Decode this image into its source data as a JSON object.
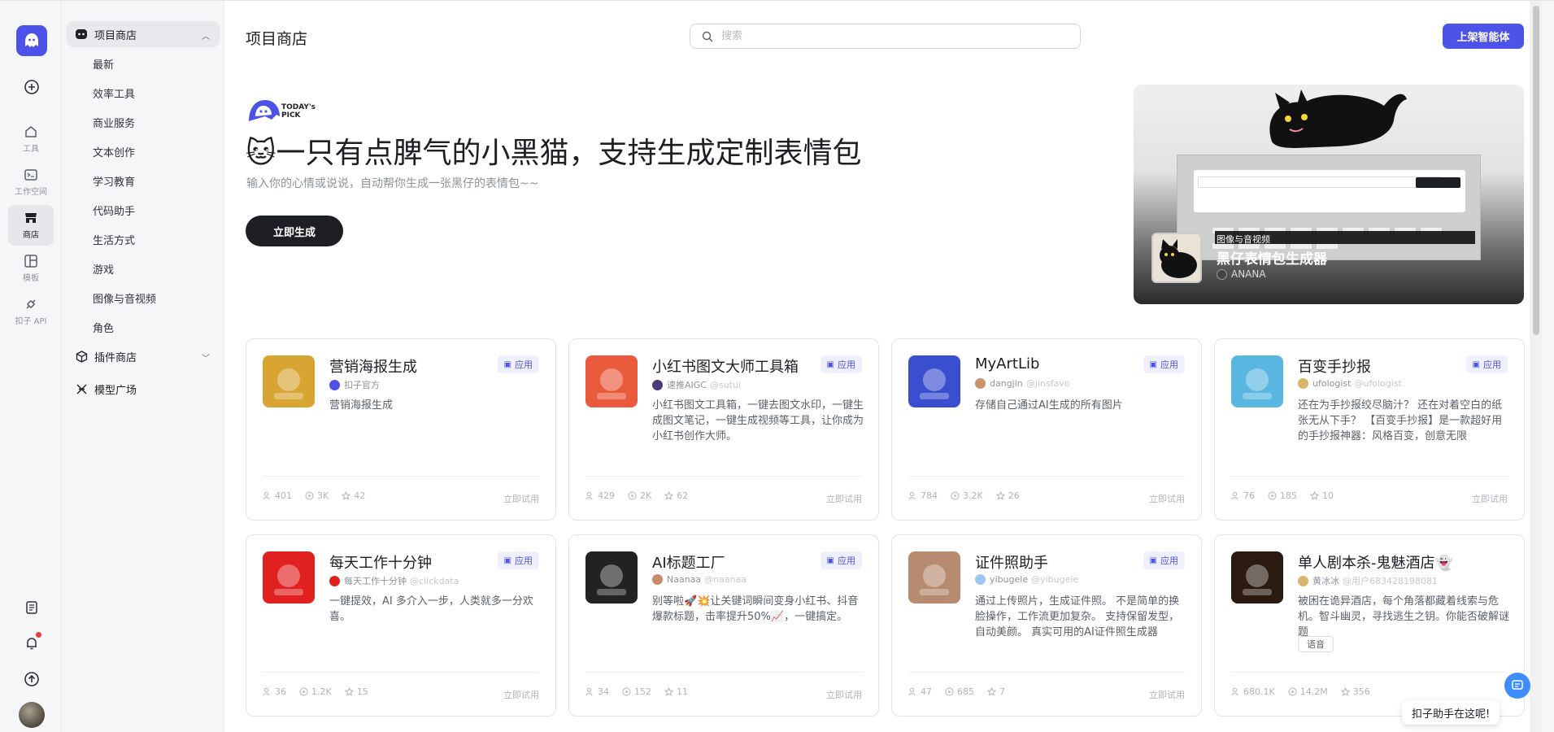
{
  "rail": {
    "items": [
      {
        "label": "工具",
        "icon": "home-icon"
      },
      {
        "label": "工作空间",
        "icon": "terminal-icon"
      },
      {
        "label": "商店",
        "icon": "store-icon"
      },
      {
        "label": "模板",
        "icon": "template-icon"
      },
      {
        "label": "扣子 API",
        "icon": "api-icon"
      }
    ]
  },
  "sidebar": {
    "store_label": "项目商店",
    "sub_items": [
      "最新",
      "效率工具",
      "商业服务",
      "文本创作",
      "学习教育",
      "代码助手",
      "生活方式",
      "游戏",
      "图像与音视频",
      "角色"
    ],
    "plugin_store_label": "插件商店",
    "model_plaza_label": "模型广场"
  },
  "header": {
    "title": "项目商店",
    "search_placeholder": "搜索",
    "publish_label": "上架智能体"
  },
  "hero": {
    "pick_label": "TODAY's PICK",
    "title": "🐱一只有点脾气的小黑猫，支持生成定制表情包",
    "description": "输入你的心情或说说，自动帮你生成一张黑仔的表情包~~",
    "cta_label": "立即生成",
    "banner": {
      "category": "图像与音视频",
      "name": "黑仔表情包生成器",
      "author": "ANANA"
    }
  },
  "cards": [
    {
      "name": "营销海报生成",
      "tag": "应用",
      "author": "扣子官方",
      "handle": "",
      "desc": "营销海报生成",
      "users": "401",
      "runs": "3K",
      "stars": "42",
      "try": "立即试用",
      "accent": "#d8a533",
      "av": "#4d53e8"
    },
    {
      "name": "小红书图文大师工具箱",
      "tag": "应用",
      "author": "速推AIGC",
      "handle": "@sutui",
      "desc": "小红书图文工具箱，一键去图文水印，一键生成图文笔记，一键生成视频等工具，让你成为小红书创作大师。",
      "users": "429",
      "runs": "2K",
      "stars": "62",
      "try": "立即试用",
      "accent": "#ea5a3d",
      "av": "#4a3a7a"
    },
    {
      "name": "MyArtLib",
      "tag": "应用",
      "author": "dangjin",
      "handle": "@jinsfavo",
      "desc": "存储自己通过AI生成的所有图片",
      "users": "784",
      "runs": "3.2K",
      "stars": "26",
      "try": "立即试用",
      "accent": "#3a4ed0",
      "av": "#c9936b"
    },
    {
      "name": "百变手抄报",
      "tag": "应用",
      "author": "ufologist",
      "handle": "@ufologist",
      "desc": "还在为手抄报绞尽脑汁？ 还在对着空白的纸张无从下手？ 【百变手抄报】是一款超好用的手抄报神器：风格百变，创意无限",
      "users": "76",
      "runs": "185",
      "stars": "10",
      "try": "立即试用",
      "accent": "#58b6e0",
      "av": "#d8b56b"
    },
    {
      "name": "每天工作十分钟",
      "tag": "应用",
      "author": "每天工作十分钟",
      "handle": "@clickdata",
      "desc": "一键提效，AI 多介入一步，人类就多一分欢喜。",
      "users": "36",
      "runs": "1.2K",
      "stars": "15",
      "try": "立即试用",
      "accent": "#e0211f",
      "av": "#e0211f"
    },
    {
      "name": "AI标题工厂",
      "tag": "应用",
      "author": "Naanaa",
      "handle": "@naanaa",
      "desc": "别等啦🚀💥让关键词瞬间变身小红书、抖音爆款标题，击率提升50%📈，一键搞定。",
      "users": "34",
      "runs": "152",
      "stars": "11",
      "try": "立即试用",
      "accent": "#222222",
      "av": "#c98a6b"
    },
    {
      "name": "证件照助手",
      "tag": "应用",
      "author": "yibugele",
      "handle": "@yibugele",
      "desc": "通过上传照片，生成证件照。 不是简单的换脸操作，工作流更加复杂。 支持保留发型，自动美颜。 真实可用的AI证件照生成器",
      "users": "47",
      "runs": "685",
      "stars": "7",
      "try": "立即试用",
      "accent": "#b88a70",
      "av": "#9ec6f0"
    },
    {
      "name": "单人剧本杀-鬼魅酒店👻",
      "tag": "",
      "author": "黄冰冰",
      "handle": "@用户6834281980​81",
      "desc": "被困在诡异酒店，每个角落都藏着线索与危机。智斗幽灵，寻找逃生之钥。你能否破解谜题",
      "chip": "语音",
      "users": "680.1K",
      "runs": "14.2M",
      "stars": "356",
      "try": "",
      "accent": "#2b1a10",
      "av": "#d8b56b"
    }
  ],
  "assistant": {
    "label": "扣子助手在这呢!"
  }
}
